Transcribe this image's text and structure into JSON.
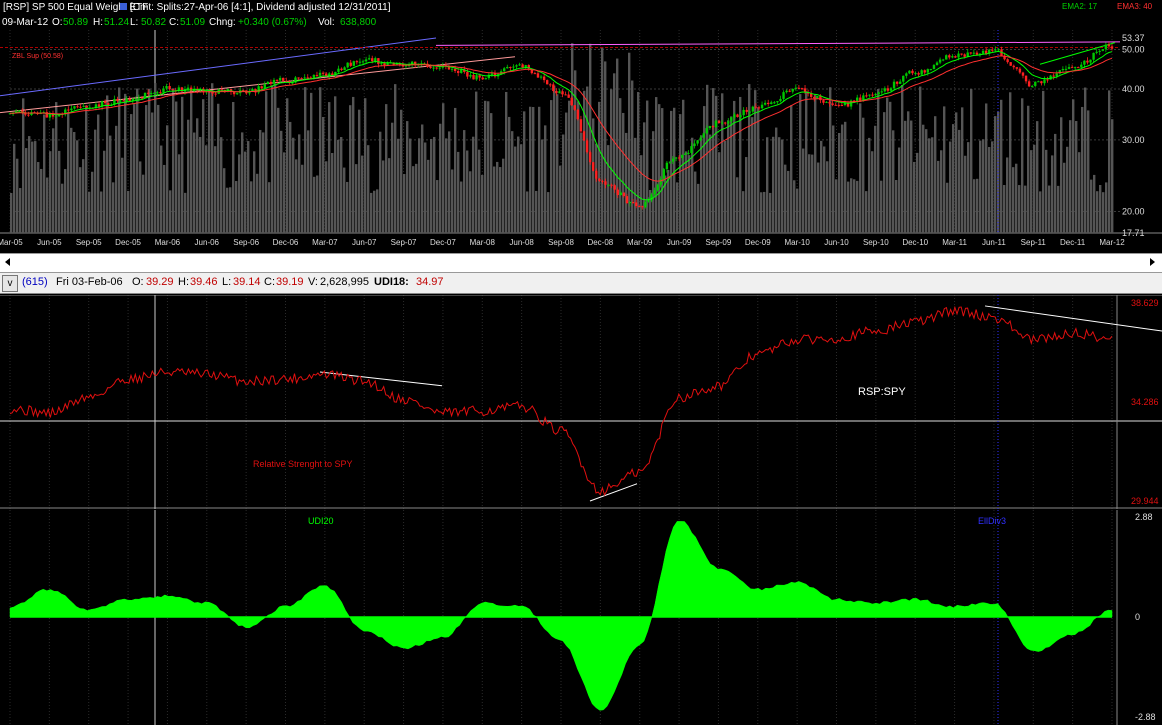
{
  "header": {
    "ticker": "[RSP] SP 500 Equal Weight ETF",
    "comment": "[Cmt: Splits:27-Apr-06 [4:1], Dividend adjusted 12/31/2011]",
    "ema1_label": "EMA2: 17",
    "ema2_label": "EMA3: 40",
    "date": "09-Mar-12",
    "open_label": "O:",
    "open_value": "50.89",
    "high_label": "H:",
    "high_value": "51.24",
    "low_label": "L:",
    "low_value": "50.82",
    "close_label": "C:",
    "close_value": "51.09",
    "change_label": "Chng:",
    "change_value": "+0.340 (0.67%)",
    "volume_label": "Vol:",
    "volume_value": "638,800",
    "annotation": "ZBL Sup (50.58)"
  },
  "infobar": {
    "toggle": "v",
    "count": "(615)",
    "date": "Fri 03-Feb-06",
    "open_label": "O:",
    "open_value": "39.29",
    "high_label": "H:",
    "high_value": "39.46",
    "low_label": "L:",
    "low_value": "39.14",
    "close_label": "C:",
    "close_value": "39.19",
    "volume_label": "V:",
    "volume_value": "2,628,995",
    "udi_label": "UDI18:",
    "udi_value": "34.97"
  },
  "colors": {
    "up_candle": "#00c800",
    "down_candle": "#ff2020",
    "volume": "#555555",
    "ema1": "#00ff00",
    "ema2": "#ff3030",
    "ratio": "#e01010",
    "udi_fill": "#00ff00",
    "trendline": "#ffffff",
    "cursor": "#3030ff"
  },
  "chart_data": [
    {
      "type": "candlestick",
      "panel": "price",
      "log_scale": true,
      "x": [
        "2005-03",
        "2005-06",
        "2005-09",
        "2005-12",
        "2006-03",
        "2006-06",
        "2006-09",
        "2006-12",
        "2007-03",
        "2007-06",
        "2007-09",
        "2007-12",
        "2008-03",
        "2008-06",
        "2008-09",
        "2008-12",
        "2009-03",
        "2009-06",
        "2009-09",
        "2009-12",
        "2010-03",
        "2010-06",
        "2010-09",
        "2010-12",
        "2011-03",
        "2011-06",
        "2011-09",
        "2011-12",
        "2012-03"
      ],
      "close": [
        35.5,
        34.5,
        36.5,
        37.5,
        40.0,
        39.5,
        39.5,
        42.0,
        43.5,
        47.0,
        46.0,
        45.0,
        42.5,
        45.5,
        39.5,
        23.5,
        20.5,
        27.5,
        33.0,
        36.0,
        40.0,
        36.0,
        39.0,
        44.0,
        48.5,
        49.5,
        41.0,
        45.0,
        51.09
      ],
      "xlabels": [
        "Mar-05",
        "Jun-05",
        "Sep-05",
        "Dec-05",
        "Mar-06",
        "Jun-06",
        "Sep-06",
        "Dec-06",
        "Mar-07",
        "Jun-07",
        "Sep-07",
        "Dec-07",
        "Mar-08",
        "Jun-08",
        "Sep-08",
        "Dec-08",
        "Mar-09",
        "Jun-09",
        "Sep-09",
        "Dec-09",
        "Mar-10",
        "Jun-10",
        "Sep-10",
        "Dec-10",
        "Mar-11",
        "Jun-11",
        "Sep-11",
        "Dec-11",
        "Mar-12"
      ],
      "yticks": [
        "53.37",
        "50.00",
        "40.00",
        "30.00",
        "20.00",
        "17.71"
      ],
      "ylim": [
        17.71,
        53.37
      ],
      "series": [
        {
          "name": "EMA2: 17"
        },
        {
          "name": "EMA3: 40"
        }
      ]
    },
    {
      "type": "line",
      "panel": "relative-strength",
      "x": [
        "2005-03",
        "2005-06",
        "2005-09",
        "2005-12",
        "2006-03",
        "2006-06",
        "2006-09",
        "2006-12",
        "2007-03",
        "2007-06",
        "2007-09",
        "2007-12",
        "2008-03",
        "2008-06",
        "2008-09",
        "2008-12",
        "2009-03",
        "2009-06",
        "2009-09",
        "2009-12",
        "2010-03",
        "2010-06",
        "2010-09",
        "2010-12",
        "2011-03",
        "2011-06",
        "2011-09",
        "2011-12",
        "2012-03"
      ],
      "values": [
        34.0,
        33.8,
        34.5,
        35.3,
        35.6,
        35.5,
        35.2,
        35.3,
        35.5,
        35.2,
        34.4,
        33.8,
        33.9,
        34.1,
        33.0,
        30.4,
        31.2,
        34.5,
        35.0,
        36.4,
        37.0,
        37.1,
        37.4,
        37.8,
        38.3,
        38.0,
        37.0,
        37.3,
        37.1
      ],
      "yticks": [
        "38.629",
        "34.286",
        "29.944"
      ],
      "ylim": [
        29.944,
        38.629
      ],
      "labels": [
        "RSP:SPY",
        "Relative Strenght to SPY"
      ]
    },
    {
      "type": "area",
      "panel": "udi",
      "title": "UDI20",
      "x": [
        "2005-03",
        "2005-06",
        "2005-09",
        "2005-12",
        "2006-03",
        "2006-06",
        "2006-09",
        "2006-12",
        "2007-03",
        "2007-06",
        "2007-09",
        "2007-12",
        "2008-03",
        "2008-06",
        "2008-09",
        "2008-12",
        "2009-03",
        "2009-06",
        "2009-09",
        "2009-12",
        "2010-03",
        "2010-06",
        "2010-09",
        "2010-12",
        "2011-03",
        "2011-06",
        "2011-09",
        "2011-12",
        "2012-03"
      ],
      "values": [
        0.3,
        0.8,
        0.2,
        0.5,
        0.6,
        0.4,
        -0.3,
        0.3,
        0.9,
        -0.4,
        -0.9,
        -0.6,
        0.4,
        0.3,
        -0.7,
        -2.7,
        -0.8,
        2.8,
        1.4,
        0.8,
        1.0,
        0.5,
        0.4,
        0.5,
        0.3,
        0.4,
        -1.0,
        -0.5,
        0.2
      ],
      "yticks": [
        "2.88",
        "0",
        "-2.88"
      ],
      "ylim": [
        -2.88,
        2.88
      ],
      "annotation": "EllDiv3"
    }
  ]
}
